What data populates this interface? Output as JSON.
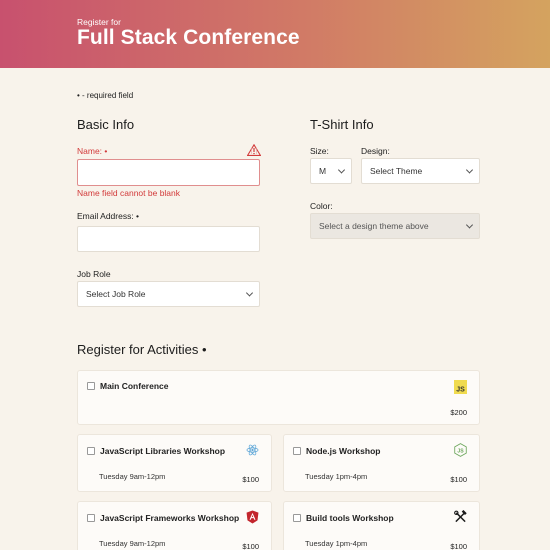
{
  "header": {
    "pre_title": "Register for",
    "title": "Full Stack Conference"
  },
  "required_note": "• - required field",
  "basic_info": {
    "heading": "Basic Info",
    "name_label": "Name: •",
    "name_value": "",
    "name_error": "Name field cannot be blank",
    "email_label": "Email Address: •",
    "email_value": "",
    "job_role_label": "Job Role",
    "job_role_selected": "Select Job Role"
  },
  "tshirt": {
    "heading": "T-Shirt Info",
    "size_label": "Size:",
    "size_selected": "M",
    "design_label": "Design:",
    "design_selected": "Select Theme",
    "color_label": "Color:",
    "color_selected": "Select a design theme above"
  },
  "activities": {
    "heading": "Register for Activities •",
    "items": [
      {
        "name": "Main Conference",
        "time": "",
        "cost": "$200",
        "icon": "js-icon",
        "checked": false
      },
      {
        "name": "JavaScript Libraries Workshop",
        "time": "Tuesday 9am-12pm",
        "cost": "$100",
        "icon": "react-icon",
        "checked": false
      },
      {
        "name": "Node.js Workshop",
        "time": "Tuesday 1pm-4pm",
        "cost": "$100",
        "icon": "nodejs-icon",
        "checked": false
      },
      {
        "name": "JavaScript Frameworks Workshop",
        "time": "Tuesday 9am-12pm",
        "cost": "$100",
        "icon": "angular-icon",
        "checked": false
      },
      {
        "name": "Build tools Workshop",
        "time": "Tuesday 1pm-4pm",
        "cost": "$100",
        "icon": "tools-icon",
        "checked": false
      }
    ]
  },
  "colors": {
    "error": "#d23a3a",
    "header_start": "#c8516e",
    "header_end": "#d4a35f",
    "background": "#f8f3eb"
  }
}
